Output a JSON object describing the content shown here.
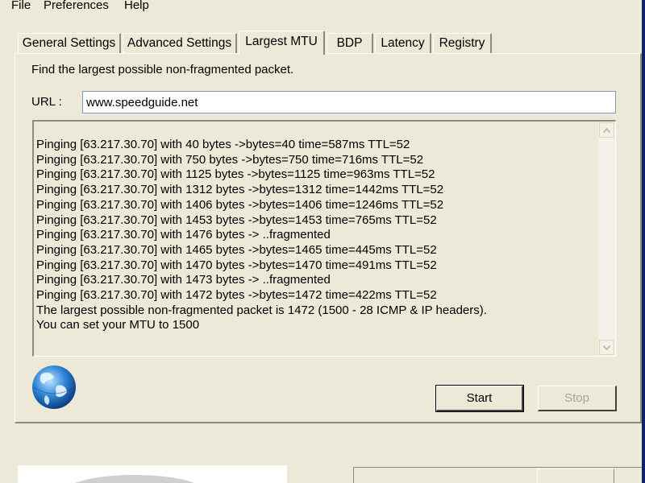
{
  "menu": [
    "File",
    "Preferences",
    "Help"
  ],
  "tabs": [
    "General Settings",
    "Advanced Settings",
    "Largest MTU",
    "BDP",
    "Latency",
    "Registry"
  ],
  "active_tab": "Largest MTU",
  "panel": {
    "description": "Find the largest possible non-fragmented packet.",
    "url_label": "URL :",
    "url_value": "www.speedguide.net",
    "output_lines": [
      "Pinging [63.217.30.70] with 40 bytes ->bytes=40 time=587ms TTL=52",
      "Pinging [63.217.30.70] with 750 bytes ->bytes=750 time=716ms TTL=52",
      "Pinging [63.217.30.70] with 1125 bytes ->bytes=1125 time=963ms TTL=52",
      "Pinging [63.217.30.70] with 1312 bytes ->bytes=1312 time=1442ms TTL=52",
      "Pinging [63.217.30.70] with 1406 bytes ->bytes=1406 time=1246ms TTL=52",
      "Pinging [63.217.30.70] with 1453 bytes ->bytes=1453 time=765ms TTL=52",
      "Pinging [63.217.30.70] with 1476 bytes -> ..fragmented",
      "Pinging [63.217.30.70] with 1465 bytes ->bytes=1465 time=445ms TTL=52",
      "Pinging [63.217.30.70] with 1470 bytes ->bytes=1470 time=491ms TTL=52",
      "Pinging [63.217.30.70] with 1473 bytes -> ..fragmented",
      "Pinging [63.217.30.70] with 1472 bytes ->bytes=1472 time=422ms TTL=52",
      "The largest possible non-fragmented packet is 1472  (1500 - 28 ICMP & IP headers).",
      "You can set your MTU to 1500"
    ],
    "start_label": "Start",
    "stop_label": "Stop"
  },
  "icons": {
    "globe": "globe-icon",
    "scroll_up": "chevron-up-icon",
    "scroll_down": "chevron-down-icon"
  },
  "colors": {
    "window_bg": "#ece9d8",
    "input_border": "#7f9db9",
    "disabled_text": "#a8a595",
    "title_blue": "#0a246a"
  }
}
